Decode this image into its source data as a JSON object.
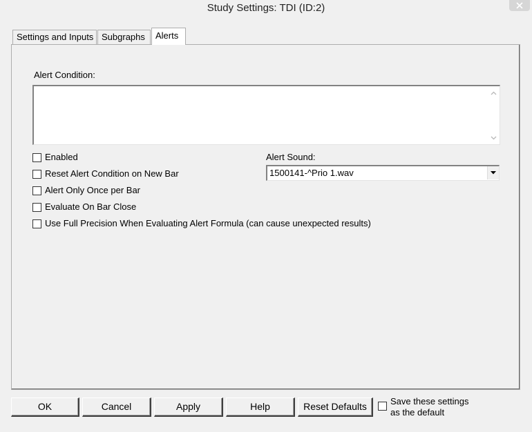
{
  "window": {
    "title": "Study Settings: TDI (ID:2)"
  },
  "tabs": [
    {
      "label": "Settings and Inputs"
    },
    {
      "label": "Subgraphs"
    },
    {
      "label": "Alerts"
    }
  ],
  "alerts": {
    "condition_label": "Alert Condition:",
    "condition_value": "",
    "options": [
      {
        "label": "Enabled",
        "checked": false
      },
      {
        "label": "Reset Alert Condition on New Bar",
        "checked": false
      },
      {
        "label": "Alert Only Once per Bar",
        "checked": false
      },
      {
        "label": "Evaluate On Bar Close",
        "checked": false
      },
      {
        "label": "Use Full Precision When Evaluating Alert Formula (can cause unexpected results)",
        "checked": false
      }
    ],
    "sound_label": "Alert Sound:",
    "sound_value": "1500141-^Prio 1.wav"
  },
  "buttons": {
    "ok": "OK",
    "cancel": "Cancel",
    "apply": "Apply",
    "help": "Help",
    "reset_defaults": "Reset Defaults"
  },
  "save_default": {
    "line1": "Save these settings",
    "line2": "as the default",
    "checked": false
  },
  "icons": {
    "close": "close-icon",
    "dropdown": "chevron-down-icon",
    "scroll_up": "scroll-up-icon",
    "scroll_down": "scroll-down-icon"
  }
}
